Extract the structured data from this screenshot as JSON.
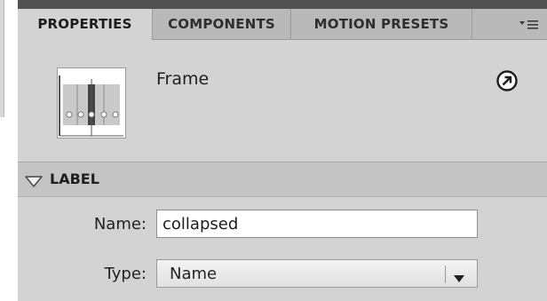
{
  "tabs": [
    {
      "label": "PROPERTIES",
      "active": true
    },
    {
      "label": "COMPONENTS",
      "active": false
    },
    {
      "label": "MOTION PRESETS",
      "active": false
    }
  ],
  "panel_menu_icon": "panel-options-menu-icon",
  "instance": {
    "title": "Frame",
    "thumbnail_icon": "frame-timeline-icon",
    "help_icon": "arrow-circle-icon"
  },
  "label_section": {
    "title": "LABEL",
    "expanded": true,
    "name_label": "Name:",
    "name_value": "collapsed",
    "type_label": "Type:",
    "type_value": "Name"
  },
  "colors": {
    "panel_bg": "#d3d3d3",
    "tab_inactive_bg": "#b9b9b9",
    "section_header_bg": "#c4c4c4",
    "top_border": "#525252"
  }
}
